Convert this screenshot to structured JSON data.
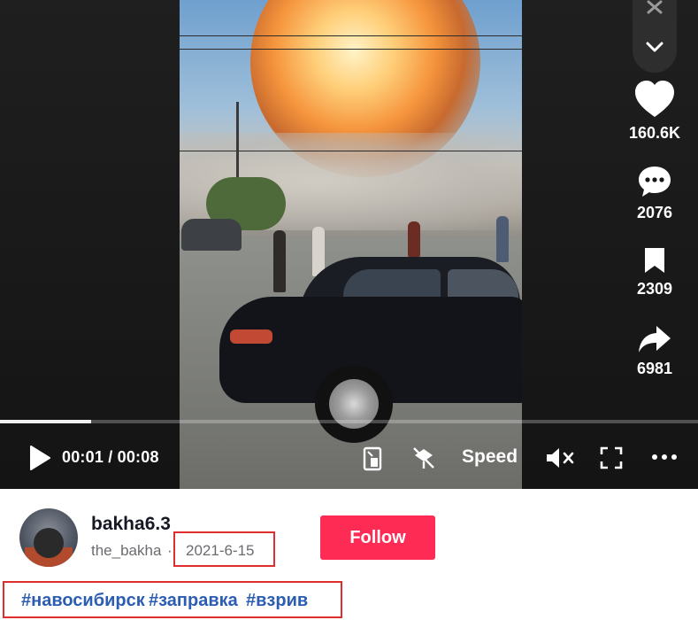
{
  "player": {
    "time_display": "00:01 / 00:08",
    "speed_label": "Speed",
    "progress_fraction": 0.13,
    "progress_color": "#f1f1f1"
  },
  "actions": {
    "likes": "160.6K",
    "comments": "2076",
    "saves": "2309",
    "shares": "6981"
  },
  "author": {
    "username": "bakha6.3",
    "nickname": "the_bakha",
    "separator": "·",
    "date": "2021-6-15",
    "follow_label": "Follow",
    "follow_color": "#fe2c55"
  },
  "hashtags": [
    "#навосибирск",
    "#заправка",
    "#взрив"
  ],
  "highlight_color": "#e02e2e",
  "icons": [
    "close-icon",
    "chevron-down-icon",
    "heart-icon",
    "comment-icon",
    "bookmark-icon",
    "share-icon",
    "play-icon",
    "pip-icon",
    "no-drone-icon",
    "mute-icon",
    "fullscreen-icon",
    "more-icon"
  ]
}
